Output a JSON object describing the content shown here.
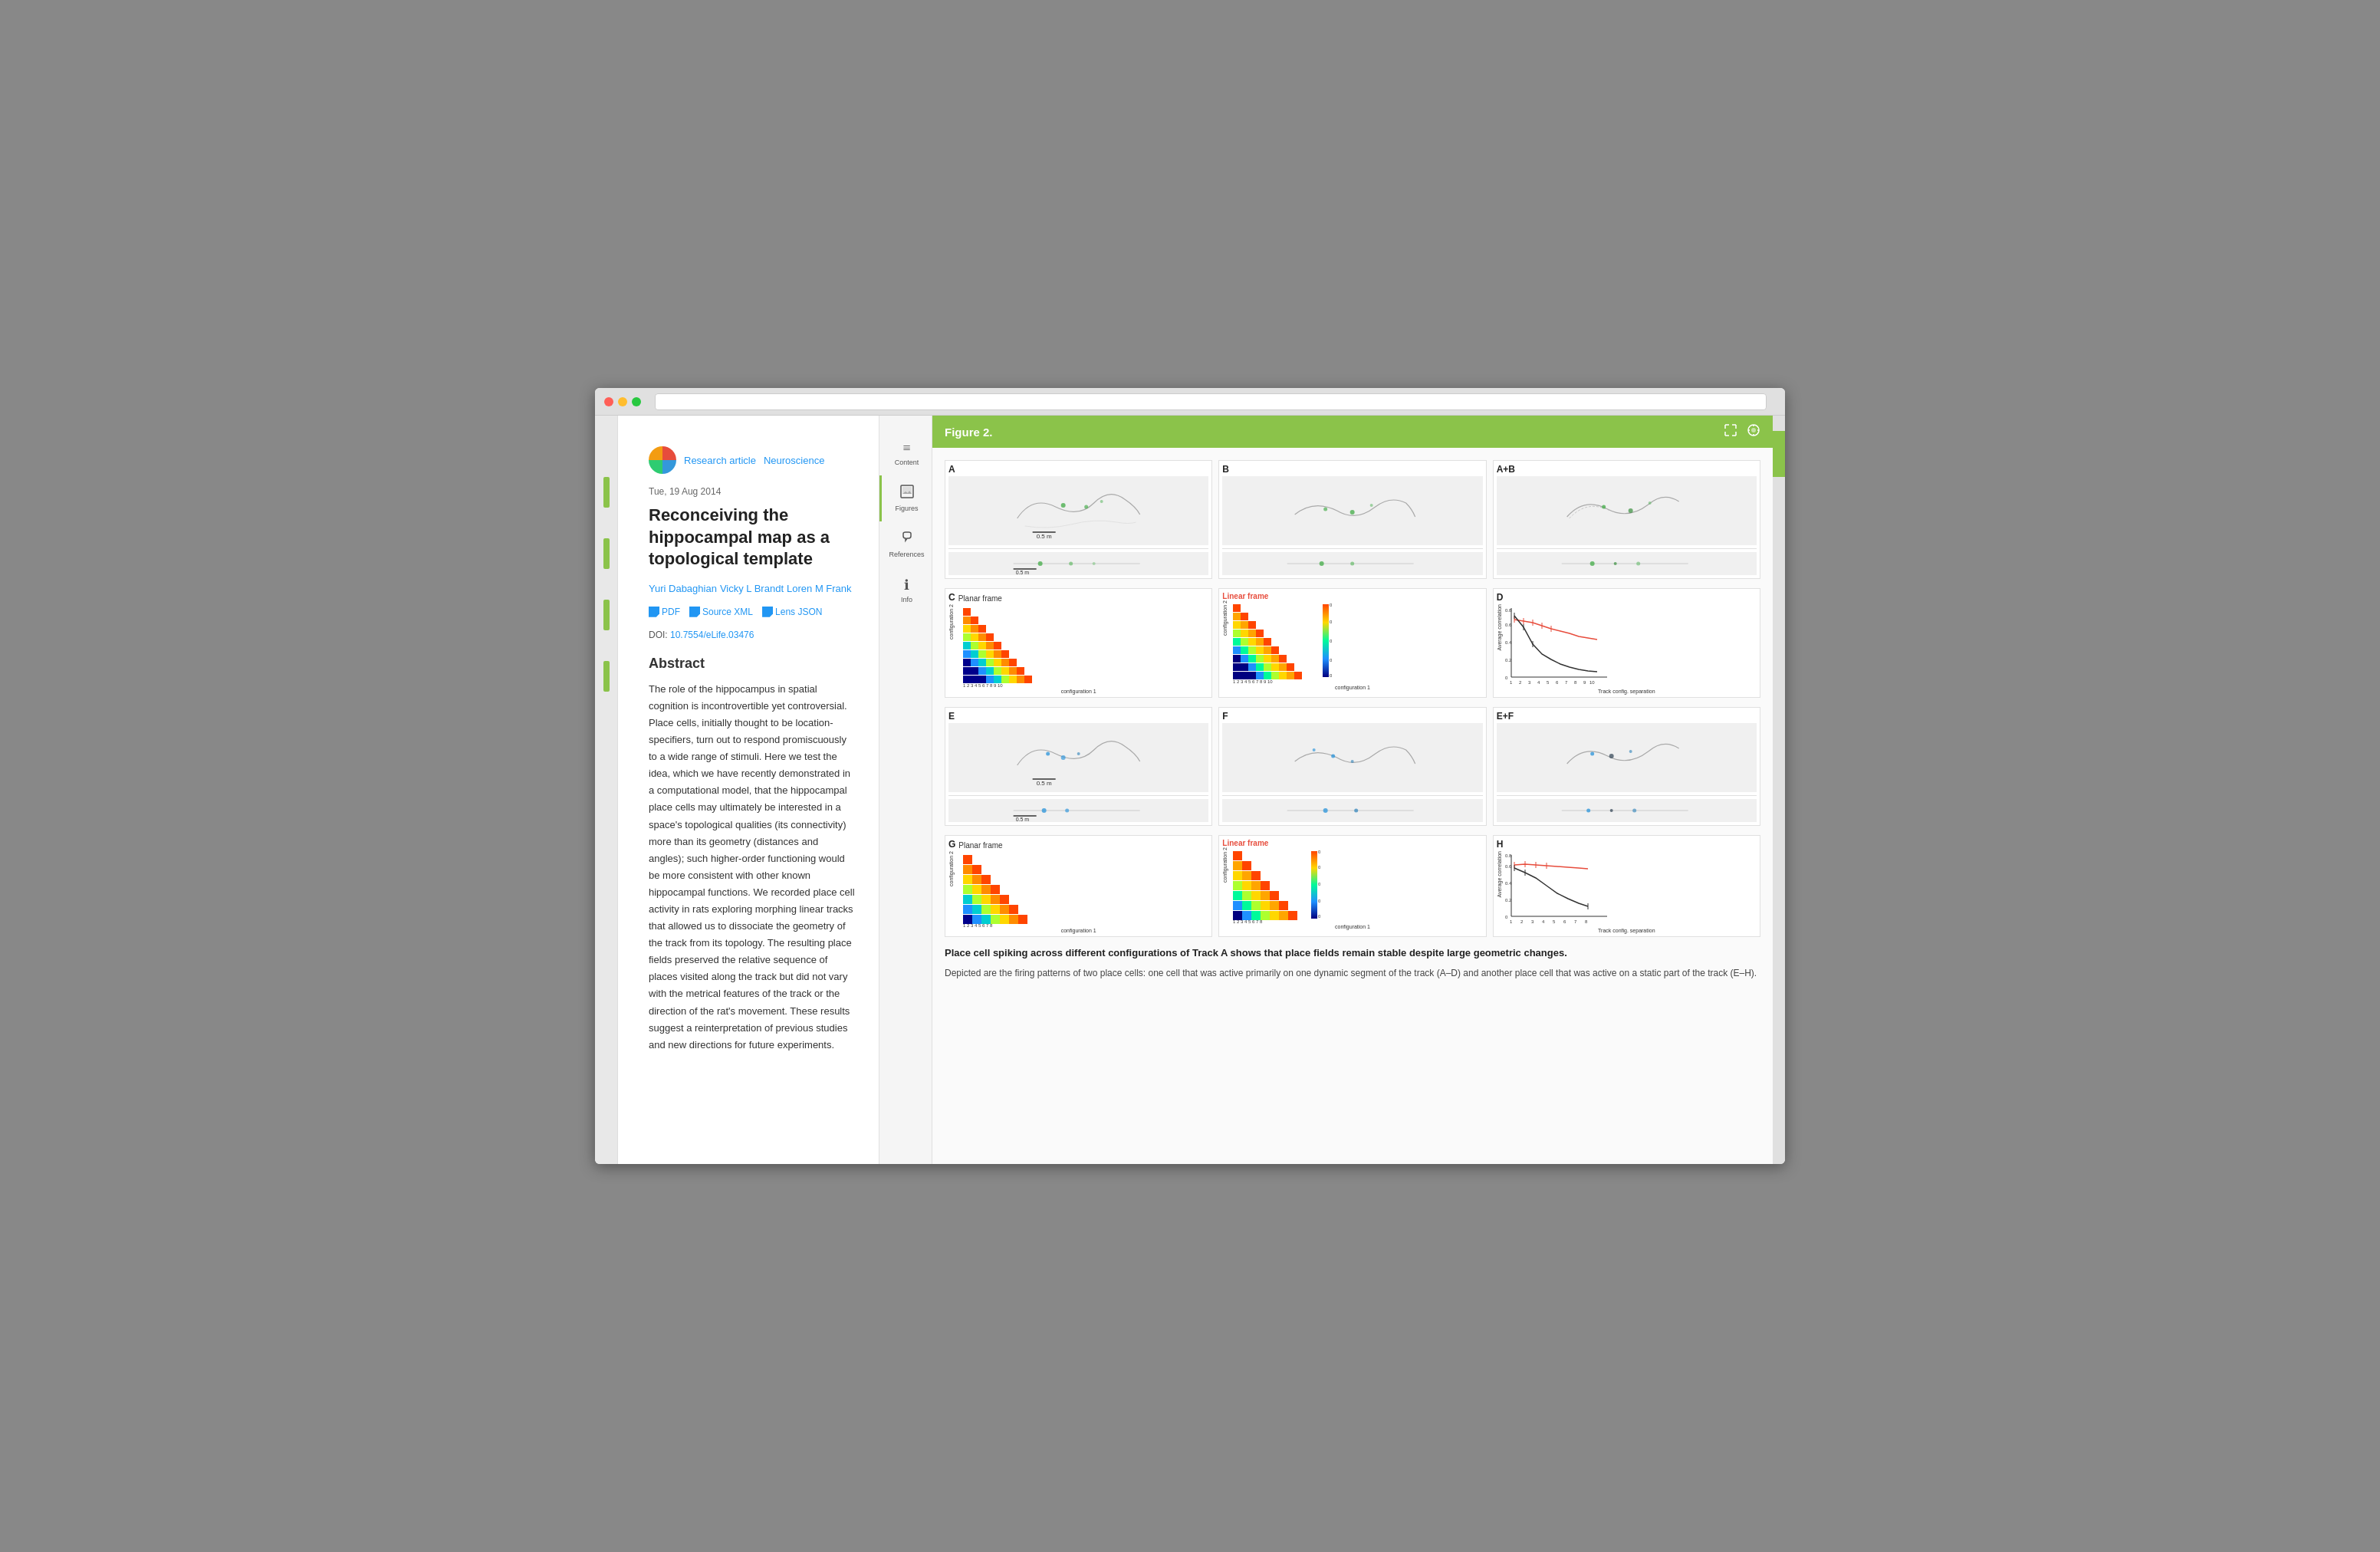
{
  "browser": {
    "addressbar": ""
  },
  "article": {
    "type": "Research article",
    "category": "Neuroscience",
    "date": "Tue, 19 Aug 2014",
    "title": "Reconceiving the hippocampal map as a topological template",
    "authors": [
      "Yuri Dabaghian",
      "Vicky L Brandt",
      "Loren M Frank"
    ],
    "links": {
      "pdf": "PDF",
      "source_xml": "Source XML",
      "lens_json": "Lens JSON"
    },
    "doi_label": "DOI:",
    "doi_value": "10.7554/eLife.03476",
    "abstract_title": "Abstract",
    "abstract_text": "The role of the hippocampus in spatial cognition is incontrovertible yet controversial. Place cells, initially thought to be location-specifiers, turn out to respond promiscuously to a wide range of stimuli. Here we test the idea, which we have recently demonstrated in a computational model, that the hippocampal place cells may ultimately be interested in a space's topological qualities (its connectivity) more than its geometry (distances and angles); such higher-order functioning would be more consistent with other known hippocampal functions. We recorded place cell activity in rats exploring morphing linear tracks that allowed us to dissociate the geometry of the track from its topology. The resulting place fields preserved the relative sequence of places visited along the track but did not vary with the metrical features of the track or the direction of the rat's movement. These results suggest a reinterpretation of previous studies and new directions for future experiments."
  },
  "nav": {
    "items": [
      {
        "label": "Content",
        "icon": "≡"
      },
      {
        "label": "Figures",
        "icon": "🖼"
      },
      {
        "label": "References",
        "icon": "🔗"
      },
      {
        "label": "Info",
        "icon": "ℹ"
      }
    ]
  },
  "figure": {
    "title": "Figure 2.",
    "caption_bold": "Place cell spiking across different configurations of Track A shows that place fields remain stable despite large geometric changes.",
    "caption_text": "Depicted are the firing patterns of two place cells: one cell that was active primarily on one dynamic segment of the track (A–D) and another place cell that was active on a static part of the track (E–H).",
    "panels": {
      "A": {
        "label": "A",
        "scale": "0.5 m"
      },
      "B": {
        "label": "B"
      },
      "AB": {
        "label": "A+B"
      },
      "C": {
        "label": "C",
        "subtitle": "Planar frame"
      },
      "C_linear": {
        "label": "",
        "subtitle": "Linear frame"
      },
      "D": {
        "label": "D"
      },
      "E": {
        "label": "E",
        "scale": "0.5 m"
      },
      "F": {
        "label": "F"
      },
      "EF": {
        "label": "E+F"
      },
      "G": {
        "label": "G",
        "subtitle": "Planar frame"
      },
      "G_linear": {
        "label": "",
        "subtitle": "Linear frame"
      },
      "H": {
        "label": "H"
      }
    }
  }
}
